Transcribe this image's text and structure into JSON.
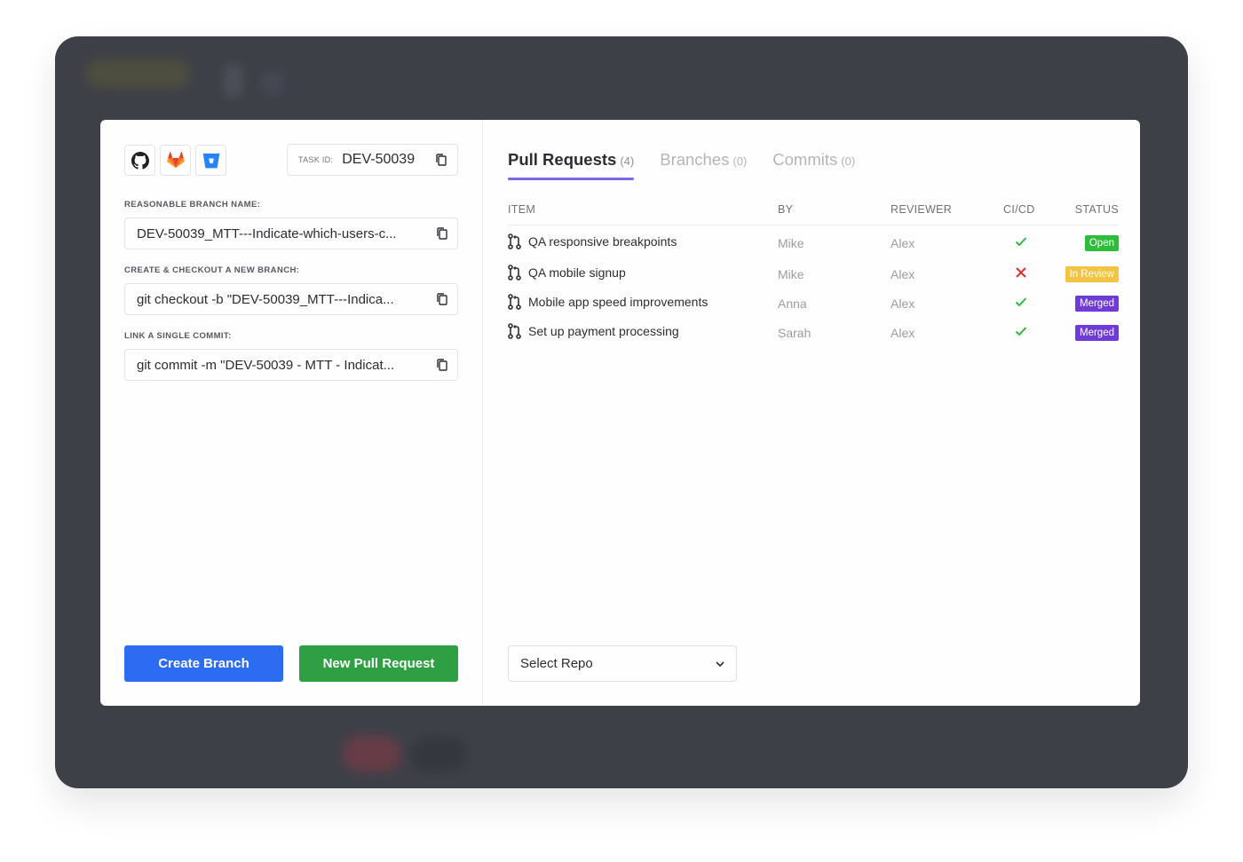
{
  "providers": [
    {
      "name": "github"
    },
    {
      "name": "gitlab"
    },
    {
      "name": "bitbucket"
    }
  ],
  "task": {
    "label": "TASK ID:",
    "value": "DEV-50039"
  },
  "fields": [
    {
      "label": "REASONABLE BRANCH NAME:",
      "value": "DEV-50039_MTT---Indicate-which-users-c..."
    },
    {
      "label": "CREATE & CHECKOUT A NEW BRANCH:",
      "value": "git checkout -b \"DEV-50039_MTT---Indica..."
    },
    {
      "label": "LINK A SINGLE COMMIT:",
      "value": "git commit -m \"DEV-50039 - MTT - Indicat..."
    }
  ],
  "buttons": {
    "create_branch": "Create Branch",
    "new_pull_request": "New Pull Request"
  },
  "tabs": [
    {
      "label": "Pull Requests",
      "count": "(4)",
      "active": true
    },
    {
      "label": "Branches",
      "count": "(0)",
      "active": false
    },
    {
      "label": "Commits",
      "count": "(0)",
      "active": false
    }
  ],
  "table": {
    "headers": {
      "item": "ITEM",
      "by": "BY",
      "reviewer": "REVIEWER",
      "cicd": "CI/CD",
      "status": "STATUS"
    },
    "rows": [
      {
        "item": "QA responsive breakpoints",
        "by": "Mike",
        "reviewer": "Alex",
        "cicd": "pass",
        "status": "Open"
      },
      {
        "item": "QA mobile signup",
        "by": "Mike",
        "reviewer": "Alex",
        "cicd": "fail",
        "status": "In Review"
      },
      {
        "item": "Mobile app speed improvements",
        "by": "Anna",
        "reviewer": "Alex",
        "cicd": "pass",
        "status": "Merged"
      },
      {
        "item": "Set up payment processing",
        "by": "Sarah",
        "reviewer": "Alex",
        "cicd": "pass",
        "status": "Merged"
      }
    ]
  },
  "status_colors": {
    "Open": "#2ebd3b",
    "In Review": "#f5c342",
    "Merged": "#6e3bd6"
  },
  "cicd_colors": {
    "pass": "#2ebd3b",
    "fail": "#e03131"
  },
  "select_repo": {
    "label": "Select Repo"
  },
  "colors": {
    "frame": "#3e4048",
    "accent": "#7b68ee",
    "blue_button": "#2c6cf0",
    "green_button": "#2ea043"
  }
}
